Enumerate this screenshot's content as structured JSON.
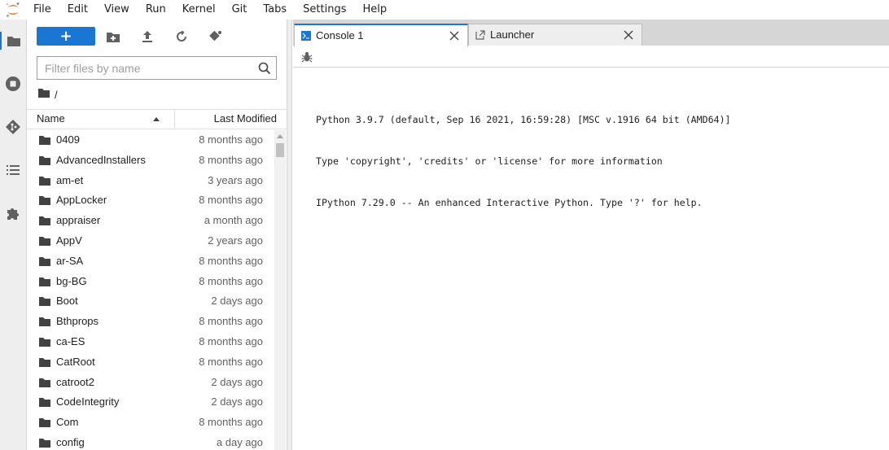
{
  "menubar": {
    "items": [
      "File",
      "Edit",
      "View",
      "Run",
      "Kernel",
      "Git",
      "Tabs",
      "Settings",
      "Help"
    ]
  },
  "activity_bar": {
    "icons": [
      "folder-icon",
      "running-icon",
      "git-icon",
      "toc-icon",
      "extension-icon"
    ]
  },
  "file_browser": {
    "new_button_label": "+",
    "search_placeholder": "Filter files by name",
    "breadcrumb_path": "/",
    "column_name": "Name",
    "column_modified": "Last Modified",
    "sort": "name-ascending",
    "scroll_position": 0.0,
    "files": [
      {
        "name": "0409",
        "modified": "8 months ago"
      },
      {
        "name": "AdvancedInstallers",
        "modified": "8 months ago"
      },
      {
        "name": "am-et",
        "modified": "3 years ago"
      },
      {
        "name": "AppLocker",
        "modified": "8 months ago"
      },
      {
        "name": "appraiser",
        "modified": "a month ago"
      },
      {
        "name": "AppV",
        "modified": "2 years ago"
      },
      {
        "name": "ar-SA",
        "modified": "8 months ago"
      },
      {
        "name": "bg-BG",
        "modified": "8 months ago"
      },
      {
        "name": "Boot",
        "modified": "2 days ago"
      },
      {
        "name": "Bthprops",
        "modified": "8 months ago"
      },
      {
        "name": "ca-ES",
        "modified": "8 months ago"
      },
      {
        "name": "CatRoot",
        "modified": "8 months ago"
      },
      {
        "name": "catroot2",
        "modified": "2 days ago"
      },
      {
        "name": "CodeIntegrity",
        "modified": "2 days ago"
      },
      {
        "name": "Com",
        "modified": "8 months ago"
      },
      {
        "name": "config",
        "modified": "a day ago"
      }
    ]
  },
  "tabs": [
    {
      "label": "Console 1",
      "active": true,
      "icon": "console-icon"
    },
    {
      "label": "Launcher",
      "active": false,
      "icon": "launcher-icon"
    }
  ],
  "console": {
    "lines": [
      "Python 3.9.7 (default, Sep 16 2021, 16:59:28) [MSC v.1916 64 bit (AMD64)]",
      "Type 'copyright', 'credits' or 'license' for more information",
      "IPython 7.29.0 -- An enhanced Interactive Python. Type '?' for help."
    ]
  },
  "colors": {
    "accent": "#1976d2",
    "logo_orange": "#f37726",
    "panel_bg": "#eeeeee",
    "border": "#d6d6d6"
  }
}
